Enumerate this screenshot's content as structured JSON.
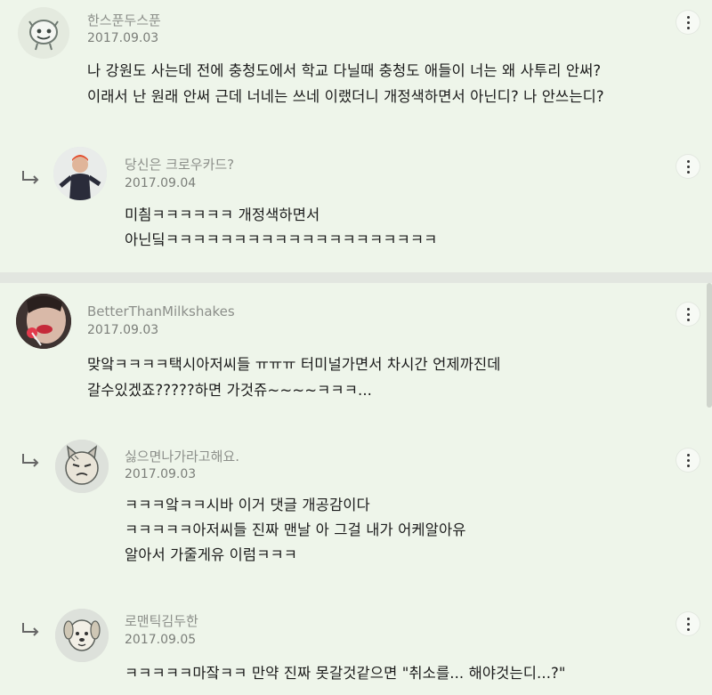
{
  "comments": [
    {
      "username": "한스푼두스푼",
      "date": "2017.09.03",
      "lines": [
        "나 강원도 사는데 전에 충청도에서 학교 다닐때 충청도 애들이 너는 왜 사투리 안써?",
        "이래서 난 원래 안써 근데 너네는 쓰네 이랬더니 개정색하면서 아닌디? 나 안쓰는디?"
      ],
      "avatar_icon": "cartoon-face-icon"
    },
    {
      "username": "당신은 크로우카드?",
      "date": "2017.09.04",
      "lines": [
        "미칌ㅋㅋㅋㅋㅋㅋ 개정색하면서",
        "아닌딬ㅋㅋㅋㅋㅋㅋㅋㅋㅋㅋㅋㅋㅋㅋㅋㅋㅋㅋㅋㅋ"
      ],
      "avatar_icon": "photo-avatar-icon"
    },
    {
      "username": "BetterThanMilkshakes",
      "date": "2017.09.03",
      "lines": [
        "맞앜ㅋㅋㅋㅋ택시아저씨들 ㅠㅠㅠ 터미널가면서 차시간 언제까진데",
        "갈수있겠죠?????하면 가것쥬~~~~ㅋㅋㅋ..."
      ],
      "avatar_icon": "photo-avatar-icon"
    },
    {
      "username": "싫으면나가라고해요.",
      "date": "2017.09.03",
      "lines": [
        "ㅋㅋㅋ앜ㅋㅋ시바 이거 댓글 개공감이다",
        "ㅋㅋㅋㅋㅋ아저씨들 진짜 맨날 아 그걸 내가 어케알아유",
        "알아서 가줄게유 이럼ㅋㅋㅋ"
      ],
      "avatar_icon": "cartoon-cat-icon"
    },
    {
      "username": "로맨틱김두한",
      "date": "2017.09.05",
      "lines": [
        "ㅋㅋㅋㅋㅋ마잨ㅋㅋ 만약 진짜 못갈것같으면 \"취소를... 해야것는디...?\""
      ],
      "avatar_icon": "cartoon-dog-icon"
    }
  ]
}
